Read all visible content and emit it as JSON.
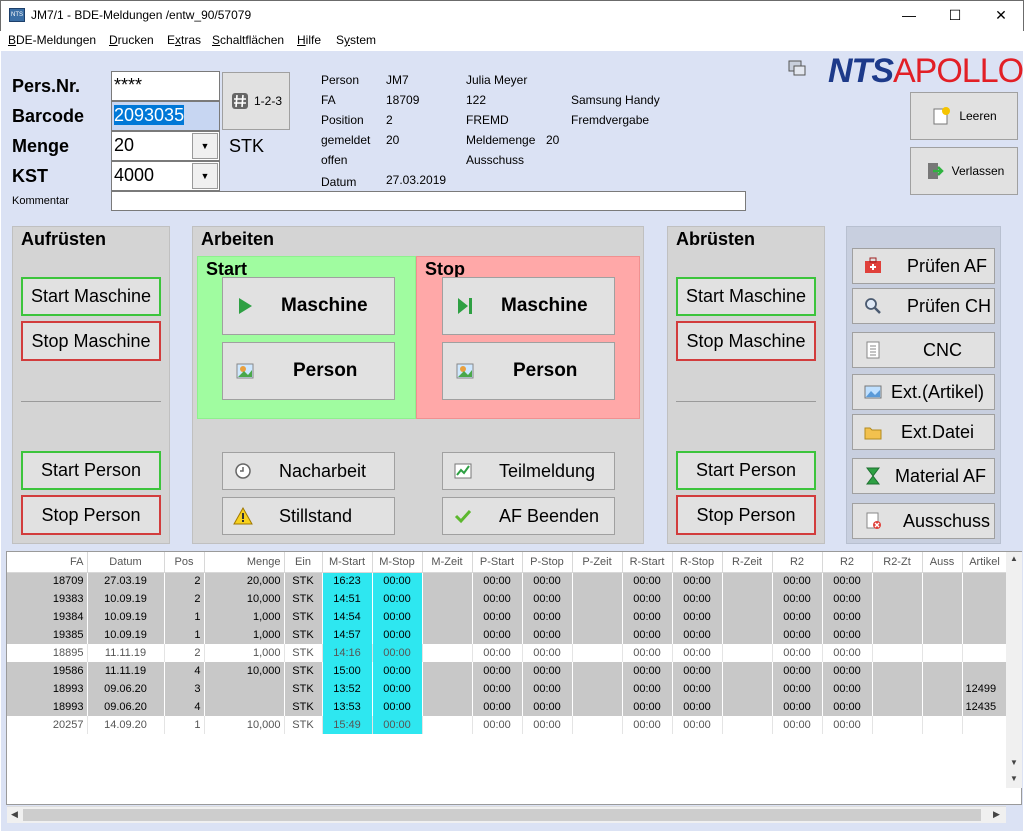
{
  "window": {
    "title": "JM7/1 - BDE-Meldungen /entw_90/57079",
    "minimize": "—",
    "maximize": "☐",
    "close": "✕"
  },
  "menu": [
    {
      "pre": "",
      "u": "B",
      "rest": "DE-Meldungen"
    },
    {
      "pre": "",
      "u": "D",
      "rest": "rucken"
    },
    {
      "pre": "E",
      "u": "x",
      "rest": "tras"
    },
    {
      "pre": "",
      "u": "S",
      "rest": "chaltflächen"
    },
    {
      "pre": "",
      "u": "H",
      "rest": "ilfe"
    },
    {
      "pre": "S",
      "u": "y",
      "rest": "stem"
    }
  ],
  "form": {
    "pers_nr_label": "Pers.Nr.",
    "pers_nr_value": "****",
    "barcode_label": "Barcode",
    "barcode_value": "2093035",
    "menge_label": "Menge",
    "menge_value": "20",
    "menge_unit": "STK",
    "kst_label": "KST",
    "kst_value": "4000",
    "kommentar_label": "Kommentar",
    "kommentar_value": "",
    "counter_label": "1-2-3"
  },
  "info": {
    "person_label": "Person",
    "person_code": "JM7",
    "person_name": "Julia Meyer",
    "fa_label": "FA",
    "fa_value": "18709",
    "fa_qty": "122",
    "fa_item": "Samsung Handy",
    "position_label": "Position",
    "position_value": "2",
    "position_type": "FREMD",
    "position_desc": "Fremdvergabe",
    "gemeldet_label": "gemeldet",
    "gemeldet_value": "20",
    "meldemenge_label": "Meldemenge",
    "meldemenge_value": "20",
    "offen_label": "offen",
    "ausschuss_label": "Ausschuss",
    "datum_label": "Datum",
    "datum_value": "27.03.2019"
  },
  "logo": {
    "nts": "NTS",
    "apollo": "APOLLO"
  },
  "right_buttons": {
    "leeren": "Leeren",
    "verlassen": "Verlassen"
  },
  "aufruesten": {
    "title": "Aufrüsten",
    "start_maschine": "Start Maschine",
    "stop_maschine": "Stop Maschine",
    "start_person": "Start Person",
    "stop_person": "Stop Person"
  },
  "arbeiten": {
    "title": "Arbeiten",
    "start_title": "Start",
    "stop_title": "Stop",
    "start_maschine": "Maschine",
    "start_person": "Person",
    "stop_maschine": "Maschine",
    "stop_person": "Person",
    "nacharbeit": "Nacharbeit",
    "teilmeldung": "Teilmeldung",
    "stillstand": "Stillstand",
    "af_beenden": "AF Beenden"
  },
  "abruesten": {
    "title": "Abrüsten",
    "start_maschine": "Start Maschine",
    "stop_maschine": "Stop Maschine",
    "start_person": "Start Person",
    "stop_person": "Stop Person"
  },
  "tools": {
    "pruefen_af": "Prüfen AF",
    "pruefen_ch": "Prüfen CH",
    "cnc": "CNC",
    "ext_artikel": "Ext.(Artikel)",
    "ext_datei": "Ext.Datei",
    "material_af": "Material AF",
    "ausschuss": "Ausschuss"
  },
  "grid": {
    "columns": [
      "FA",
      "Datum",
      "Pos",
      "Menge",
      "Ein",
      "M-Start",
      "M-Stop",
      "M-Zeit",
      "P-Start",
      "P-Stop",
      "P-Zeit",
      "R-Start",
      "R-Stop",
      "R-Zeit",
      "R2",
      "R2",
      "R2-Zt",
      "Auss",
      "Artikel"
    ],
    "rows": [
      {
        "style": "gray",
        "cells": [
          "18709",
          "27.03.19",
          "2",
          "20,000",
          "STK",
          "16:23",
          "00:00",
          "",
          "00:00",
          "00:00",
          "",
          "00:00",
          "00:00",
          "",
          "00:00",
          "00:00",
          "",
          "",
          ""
        ]
      },
      {
        "style": "gray",
        "cells": [
          "19383",
          "10.09.19",
          "2",
          "10,000",
          "STK",
          "14:51",
          "00:00",
          "",
          "00:00",
          "00:00",
          "",
          "00:00",
          "00:00",
          "",
          "00:00",
          "00:00",
          "",
          "",
          ""
        ]
      },
      {
        "style": "gray",
        "cells": [
          "19384",
          "10.09.19",
          "1",
          "1,000",
          "STK",
          "14:54",
          "00:00",
          "",
          "00:00",
          "00:00",
          "",
          "00:00",
          "00:00",
          "",
          "00:00",
          "00:00",
          "",
          "",
          ""
        ]
      },
      {
        "style": "gray",
        "cells": [
          "19385",
          "10.09.19",
          "1",
          "1,000",
          "STK",
          "14:57",
          "00:00",
          "",
          "00:00",
          "00:00",
          "",
          "00:00",
          "00:00",
          "",
          "00:00",
          "00:00",
          "",
          "",
          ""
        ]
      },
      {
        "style": "white",
        "cells": [
          "18895",
          "11.11.19",
          "2",
          "1,000",
          "STK",
          "14:16",
          "00:00",
          "",
          "00:00",
          "00:00",
          "",
          "00:00",
          "00:00",
          "",
          "00:00",
          "00:00",
          "",
          "",
          ""
        ]
      },
      {
        "style": "gray",
        "cells": [
          "19586",
          "11.11.19",
          "4",
          "10,000",
          "STK",
          "15:00",
          "00:00",
          "",
          "00:00",
          "00:00",
          "",
          "00:00",
          "00:00",
          "",
          "00:00",
          "00:00",
          "",
          "",
          ""
        ]
      },
      {
        "style": "gray",
        "cells": [
          "18993",
          "09.06.20",
          "3",
          "",
          "STK",
          "13:52",
          "00:00",
          "",
          "00:00",
          "00:00",
          "",
          "00:00",
          "00:00",
          "",
          "00:00",
          "00:00",
          "",
          "",
          "12499"
        ]
      },
      {
        "style": "gray",
        "cells": [
          "18993",
          "09.06.20",
          "4",
          "",
          "STK",
          "13:53",
          "00:00",
          "",
          "00:00",
          "00:00",
          "",
          "00:00",
          "00:00",
          "",
          "00:00",
          "00:00",
          "",
          "",
          "12435"
        ]
      },
      {
        "style": "white",
        "cells": [
          "20257",
          "14.09.20",
          "1",
          "10,000",
          "STK",
          "15:49",
          "00:00",
          "",
          "00:00",
          "00:00",
          "",
          "00:00",
          "00:00",
          "",
          "00:00",
          "00:00",
          "",
          "",
          ""
        ]
      }
    ]
  }
}
